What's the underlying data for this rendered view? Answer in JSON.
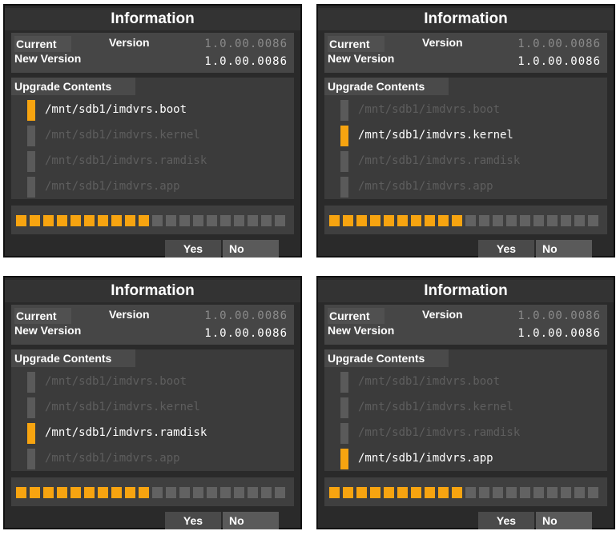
{
  "title": "Information",
  "version": {
    "current_label": "Current",
    "version_label": "Version",
    "new_label": "New Version",
    "current_value": "1.0.00.0086",
    "new_value": "1.0.00.0086"
  },
  "upgrade_title": "Upgrade Contents",
  "items": [
    "/mnt/sdb1/imdvrs.boot",
    "/mnt/sdb1/imdvrs.kernel",
    "/mnt/sdb1/imdvrs.ramdisk",
    "/mnt/sdb1/imdvrs.app"
  ],
  "progress": {
    "filled": 10,
    "total": 20
  },
  "buttons": {
    "yes": "Yes",
    "no": "No"
  },
  "colors": {
    "accent": "#f7a410",
    "background": "#2a2a2a"
  },
  "panels": [
    {
      "active_item": 0
    },
    {
      "active_item": 1
    },
    {
      "active_item": 2
    },
    {
      "active_item": 3
    }
  ]
}
